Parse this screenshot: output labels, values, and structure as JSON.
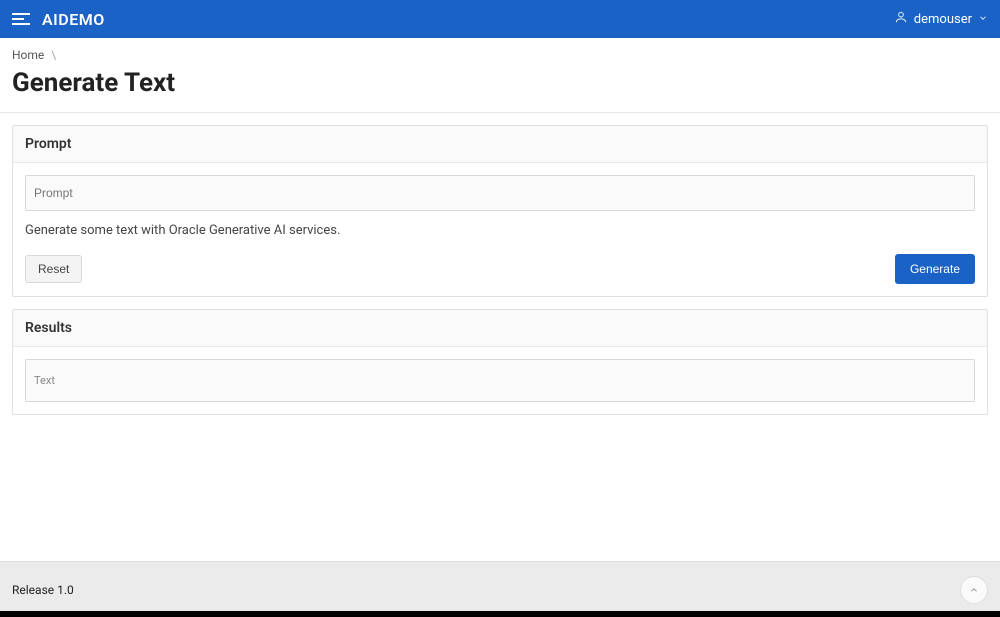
{
  "header": {
    "app_title": "AIDEMO",
    "username": "demouser"
  },
  "breadcrumb": {
    "home": "Home",
    "separator": "\\"
  },
  "page": {
    "title": "Generate Text"
  },
  "prompt_panel": {
    "title": "Prompt",
    "input_placeholder": "Prompt",
    "help_text": "Generate some text with Oracle Generative AI services.",
    "reset_label": "Reset",
    "generate_label": "Generate"
  },
  "results_panel": {
    "title": "Results",
    "output_placeholder": "Text"
  },
  "footer": {
    "release": "Release 1.0"
  }
}
